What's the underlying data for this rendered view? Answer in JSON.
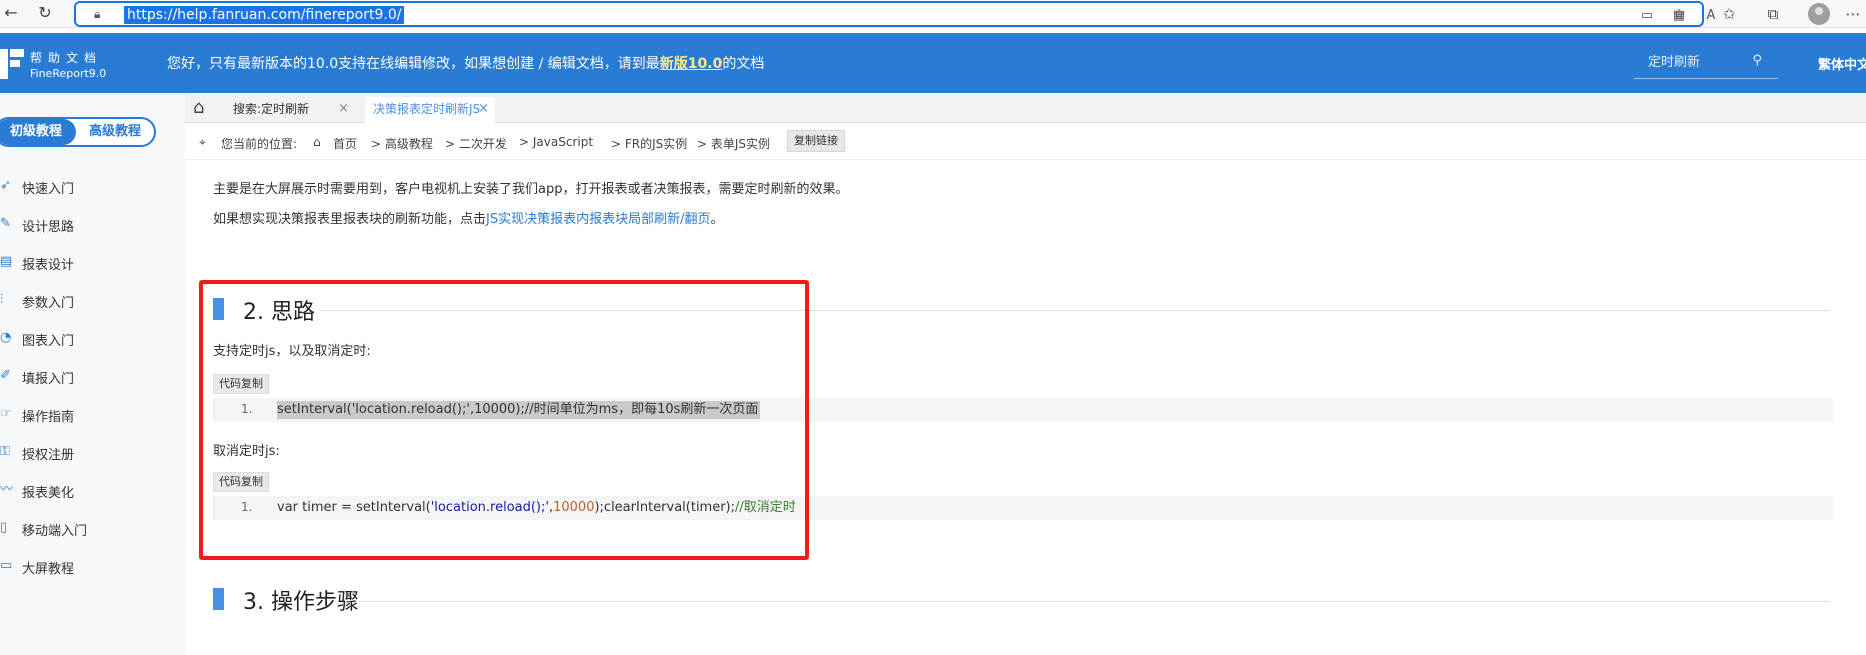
{
  "browser": {
    "url": "https://help.fanruan.com/finereport9.0/"
  },
  "header": {
    "logo_cn": "帮助文档",
    "logo_en": "FineReport9.0",
    "notice_prefix": "您好，只有最新版本的10.0支持在线编辑修改，如果想创建 / 编辑文档，请到最",
    "notice_link": "新版10.0",
    "notice_suffix": "的文档",
    "search_value": "定时刷新",
    "language": "繁体中文"
  },
  "sidebar": {
    "level_basic": "初级教程",
    "level_advanced": "高级教程",
    "items": [
      {
        "label": "快速入门",
        "icon": "rocket-icon"
      },
      {
        "label": "设计思路",
        "icon": "design-icon"
      },
      {
        "label": "报表设计",
        "icon": "report-icon"
      },
      {
        "label": "参数入门",
        "icon": "sliders-icon"
      },
      {
        "label": "图表入门",
        "icon": "chart-icon"
      },
      {
        "label": "填报入门",
        "icon": "edit-icon"
      },
      {
        "label": "操作指南",
        "icon": "guide-icon"
      },
      {
        "label": "授权注册",
        "icon": "key-icon"
      },
      {
        "label": "报表美化",
        "icon": "brush-icon"
      },
      {
        "label": "移动端入门",
        "icon": "mobile-icon"
      },
      {
        "label": "大屏教程",
        "icon": "monitor-icon"
      }
    ]
  },
  "tabs": {
    "tab1": "搜索:定时刷新",
    "tab2": "决策报表定时刷新JS",
    "close": "×"
  },
  "breadcrumb": {
    "prefix": "您当前的位置:",
    "home": "首页",
    "items": [
      "> 高级教程",
      "> 二次开发",
      "> JavaScript",
      "> FR的JS实例",
      "> 表单JS实例"
    ],
    "copy_link": "复制链接"
  },
  "content": {
    "intro": "主要是在大屏展示时需要用到，客户电视机上安装了我们app，打开报表或者决策报表，需要定时刷新的效果。",
    "intro2_prefix": "如果想实现决策报表里报表块的刷新功能，点击",
    "intro2_link": "JS实现决策报表内报表块局部刷新/翻页",
    "intro2_suffix": "。",
    "section2_title": "2. 思路",
    "support_text": "支持定时js，以及取消定时:",
    "copy_code": "代码复制",
    "line_num": "1.",
    "code1": "setInterval('location.reload();',10000);//时间单位为ms，即每10s刷新一次页面",
    "cancel_text": "取消定时js:",
    "code2_a": "var timer = setInterval(",
    "code2_b": "'location.reload();'",
    "code2_c": ",",
    "code2_d": "10000",
    "code2_e": ");clearInterval(timer);",
    "code2_f": "//取消定时",
    "section3_title": "3. 操作步骤"
  }
}
